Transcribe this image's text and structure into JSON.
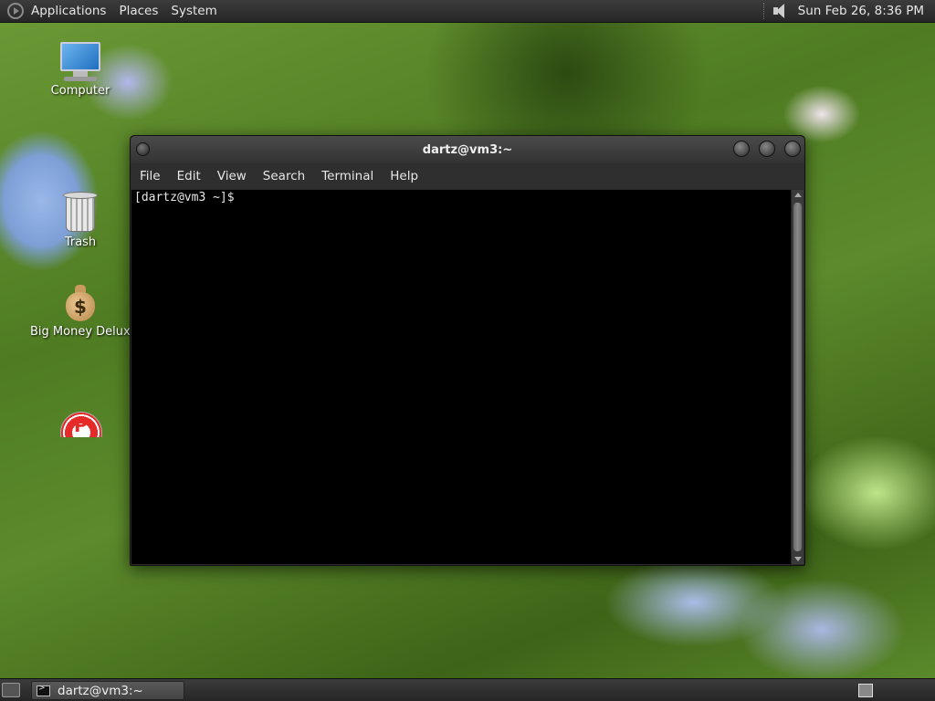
{
  "top_panel": {
    "menus": [
      "Applications",
      "Places",
      "System"
    ],
    "clock": "Sun Feb 26,  8:36 PM",
    "icons": [
      "gnome-foot-icon",
      "speaker-icon"
    ]
  },
  "desktop": {
    "icons": [
      {
        "label": "Computer",
        "icon": "computer-icon"
      },
      {
        "label": "Trash",
        "icon": "trash-icon"
      },
      {
        "label": "Big Money Deluxe",
        "icon": "money-bag-icon"
      },
      {
        "label": "",
        "icon": "p-app-icon"
      }
    ]
  },
  "window": {
    "title": "dartz@vm3:~",
    "menus": [
      "File",
      "Edit",
      "View",
      "Search",
      "Terminal",
      "Help"
    ],
    "terminal_text": "[dartz@vm3 ~]$ "
  },
  "bottom_panel": {
    "task_label": "dartz@vm3:~"
  },
  "colors": {
    "panel": "#2e2e2e",
    "terminal_bg": "#000000",
    "terminal_fg": "#e8e8e8"
  }
}
